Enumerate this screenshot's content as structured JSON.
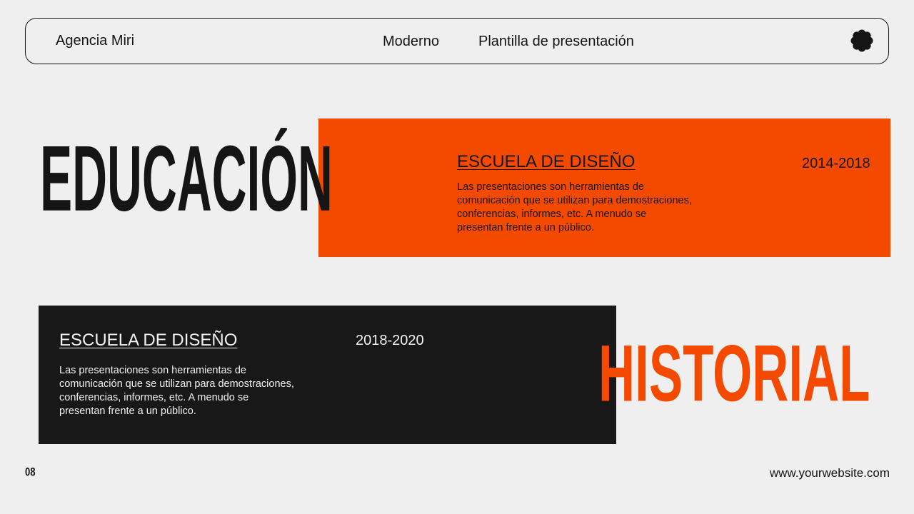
{
  "header": {
    "brand": "Agencia Miri",
    "nav": [
      "Moderno",
      "Plantilla de presentación"
    ],
    "logo_icon": "flower-icon"
  },
  "headlines": {
    "top": "EDUCACIÓN",
    "bottom": "HISTORIAL"
  },
  "entries": [
    {
      "title": "ESCUELA DE DISEÑO",
      "years": "2014-2018",
      "description": "Las presentaciones son herramientas de comunicación que se utilizan para demostraciones, conferencias, informes, etc. A menudo se presentan frente a un público."
    },
    {
      "title": "ESCUELA DE DISEÑO",
      "years": "2018-2020",
      "description": "Las presentaciones son herramientas de comunicación que se utilizan para demostraciones, conferencias, informes, etc. A menudo se presentan frente a un público."
    }
  ],
  "footer": {
    "page_number": "08",
    "website": "www.yourwebsite.com"
  },
  "colors": {
    "background": "#efefef",
    "accent": "#f34a00",
    "dark": "#181818"
  }
}
